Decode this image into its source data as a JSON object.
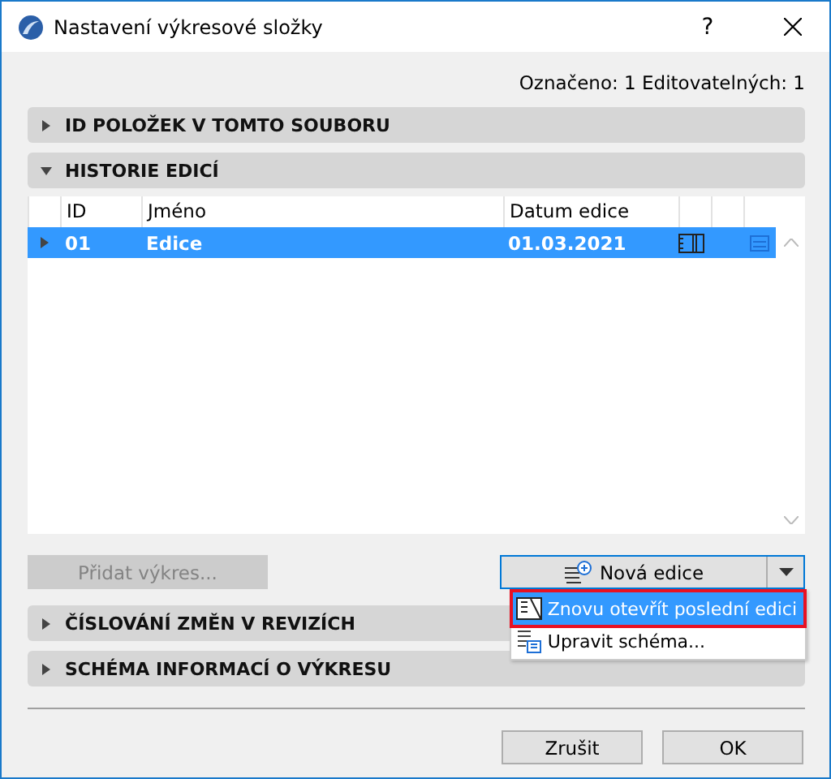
{
  "window": {
    "title": "Nastavení výkresové složky",
    "help": "?"
  },
  "summary": "Označeno: 1 Editovatelných: 1",
  "sections_top": [
    {
      "title": "ID POLOŽEK V TOMTO SOUBORU",
      "expanded": false
    },
    {
      "title": "HISTORIE EDICÍ",
      "expanded": true
    }
  ],
  "table": {
    "columns": [
      "ID",
      "Jméno",
      "Datum edice"
    ],
    "rows": [
      {
        "id": "01",
        "name": "Edice",
        "date": "01.03.2021",
        "selected": true
      }
    ]
  },
  "add_button": {
    "label": "Přidat výkres...",
    "disabled": true
  },
  "split_button": {
    "label": "Nová edice"
  },
  "menu": [
    {
      "label": "Znovu otevřít poslední edici",
      "selected": true
    },
    {
      "label": "Upravit schéma...",
      "selected": false
    }
  ],
  "sections_bottom": [
    {
      "title": "ČÍSLOVÁNÍ ZMĚN V REVIZÍCH",
      "expanded": false
    },
    {
      "title": "SCHÉMA INFORMACÍ O VÝKRESU",
      "expanded": false
    }
  ],
  "buttons": [
    "Zrušit",
    "OK"
  ]
}
